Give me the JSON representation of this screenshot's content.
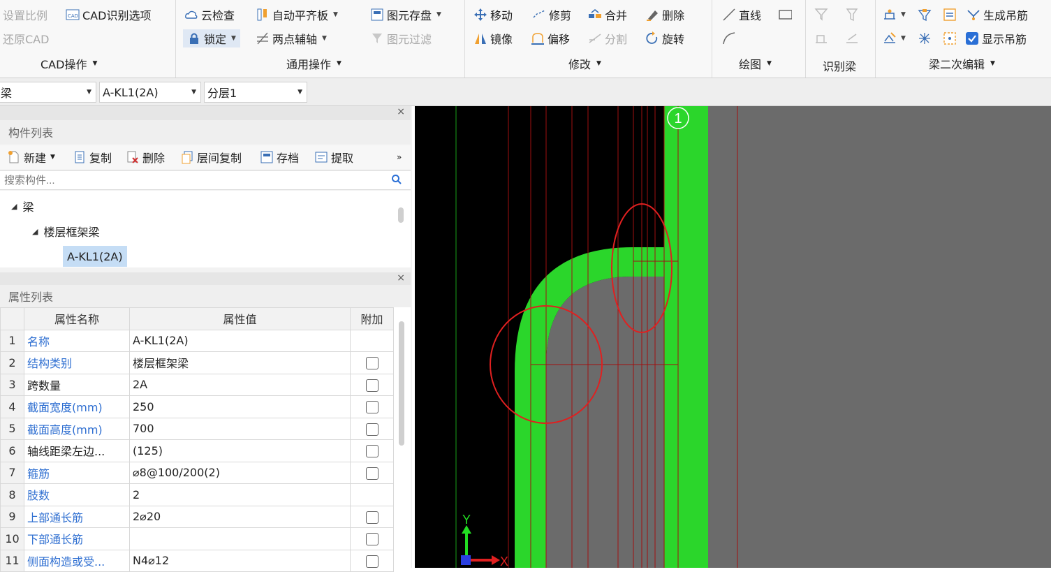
{
  "ribbon": {
    "cad": {
      "set_scale": "设置比例",
      "recognize_options": "CAD识别选项",
      "restore_cad": "还原CAD",
      "group_label": "CAD操作"
    },
    "general": {
      "cloud_check": "云检查",
      "auto_align": "自动平齐板",
      "save_elements": "图元存盘",
      "lock": "锁定",
      "two_point_axis": "两点辅轴",
      "element_filter": "图元过滤",
      "group_label": "通用操作"
    },
    "modify": {
      "move": "移动",
      "trim": "修剪",
      "merge": "合并",
      "delete": "删除",
      "mirror": "镜像",
      "offset": "偏移",
      "split": "分割",
      "rotate": "旋转",
      "group_label": "修改"
    },
    "draw": {
      "line": "直线",
      "group_label": "绘图"
    },
    "identify": {
      "group_label": "识别梁"
    },
    "beam_edit": {
      "generate_hanger": "生成吊筋",
      "show_hanger": "显示吊筋",
      "show_hanger_checked": true,
      "group_label": "梁二次编辑"
    }
  },
  "selectors": {
    "type": "梁",
    "component": "A-KL1(2A)",
    "layer": "分层1"
  },
  "component_list": {
    "title": "构件列表",
    "toolbar": {
      "new": "新建",
      "copy": "复制",
      "delete": "删除",
      "floor_copy": "层间复制",
      "archive": "存档",
      "extract": "提取"
    },
    "search_placeholder": "搜索构件...",
    "tree": {
      "root": "梁",
      "child": "楼层框架梁",
      "leaf": "A-KL1(2A)"
    }
  },
  "property_list": {
    "title": "属性列表",
    "headers": {
      "index": "",
      "name": "属性名称",
      "value": "属性值",
      "extra": "附加"
    },
    "rows": [
      {
        "n": "1",
        "name": "名称",
        "value": "A-KL1(2A)",
        "blue": true,
        "checkbox": false
      },
      {
        "n": "2",
        "name": "结构类别",
        "value": "楼层框架梁",
        "blue": true,
        "checkbox": true
      },
      {
        "n": "3",
        "name": "跨数量",
        "value": "2A",
        "blue": false,
        "checkbox": true
      },
      {
        "n": "4",
        "name": "截面宽度(mm)",
        "value": "250",
        "blue": true,
        "checkbox": true
      },
      {
        "n": "5",
        "name": "截面高度(mm)",
        "value": "700",
        "blue": true,
        "checkbox": true
      },
      {
        "n": "6",
        "name": "轴线距梁左边...",
        "value": "(125)",
        "blue": false,
        "checkbox": true
      },
      {
        "n": "7",
        "name": "箍筋",
        "value": "⌀8@100/200(2)",
        "blue": true,
        "checkbox": true
      },
      {
        "n": "8",
        "name": "肢数",
        "value": "2",
        "blue": true,
        "checkbox": false
      },
      {
        "n": "9",
        "name": "上部通长筋",
        "value": "2⌀20",
        "blue": true,
        "checkbox": true
      },
      {
        "n": "10",
        "name": "下部通长筋",
        "value": "",
        "blue": true,
        "checkbox": true
      },
      {
        "n": "11",
        "name": "侧面构造或受...",
        "value": "N4⌀12",
        "blue": true,
        "checkbox": true
      }
    ]
  },
  "canvas": {
    "axis_label": "1",
    "ucs_y": "Y",
    "ucs_x": "X"
  },
  "colors": {
    "beam": "#2bd62b",
    "cad_line": "#a01010",
    "annotation": "#e02020",
    "gray_region": "#6b6b6b"
  }
}
